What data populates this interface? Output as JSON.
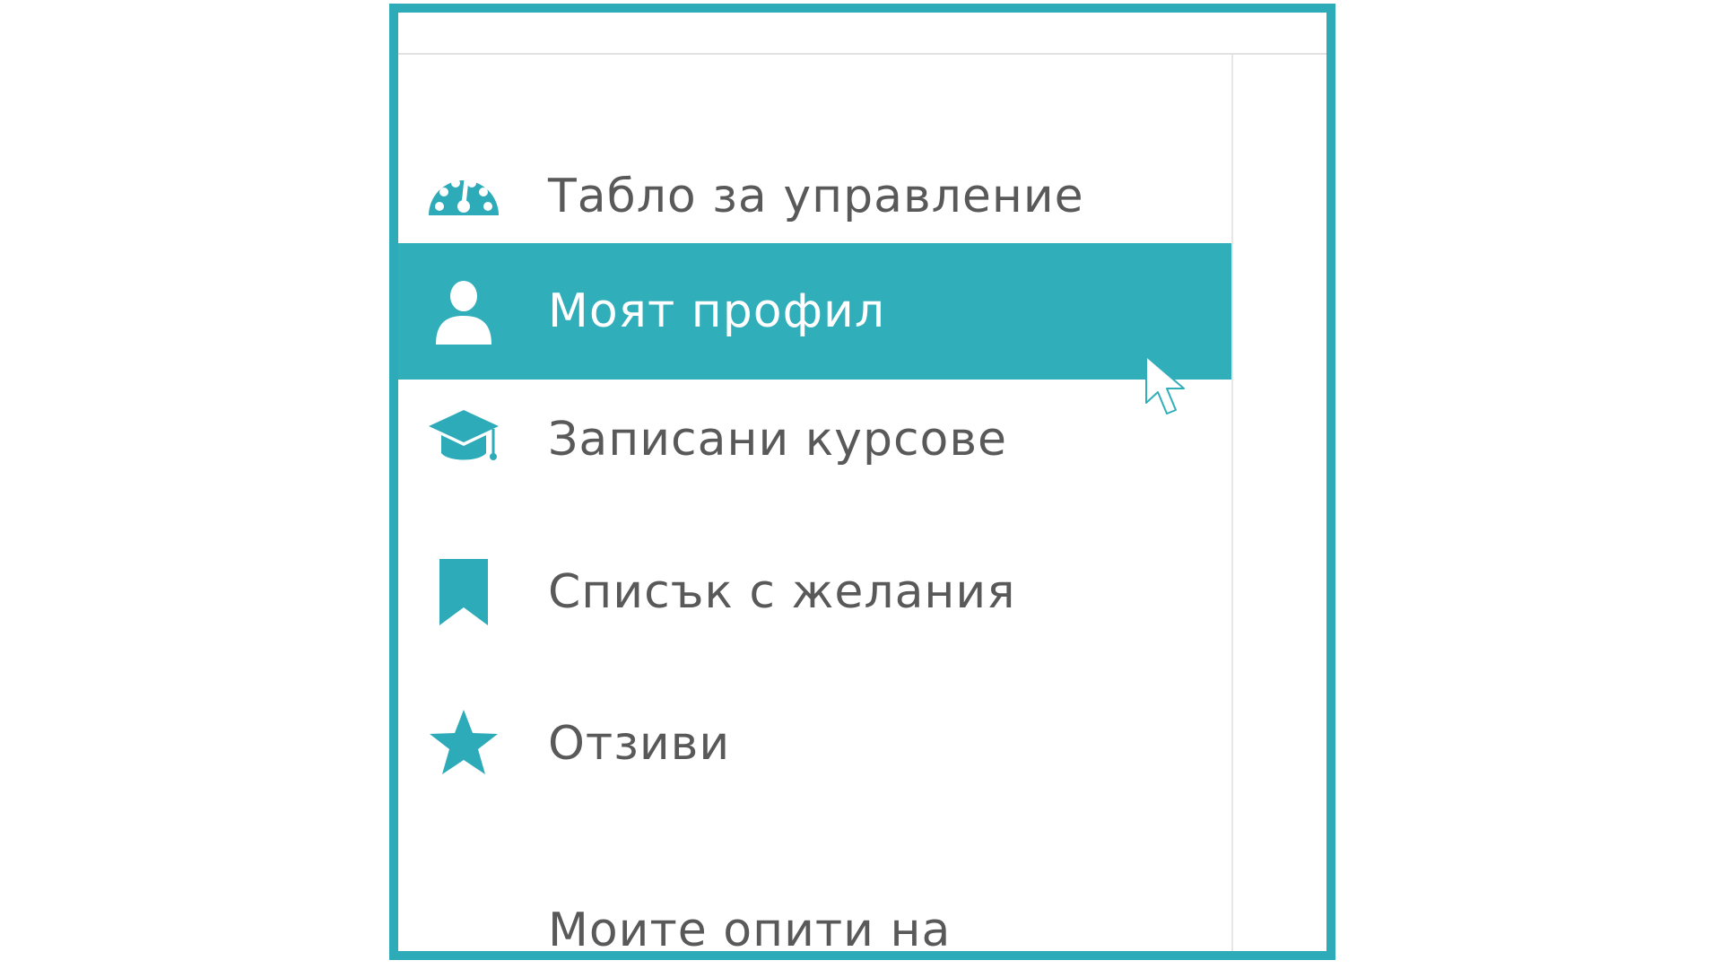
{
  "colors": {
    "accent": "#2eabb8",
    "active_bg": "#30aeb9",
    "text": "#595959",
    "active_text": "#ffffff"
  },
  "sidebar": {
    "items": [
      {
        "label": "Табло за управление",
        "icon": "dashboard-icon",
        "active": false
      },
      {
        "label": "Моят профил",
        "icon": "user-icon",
        "active": true
      },
      {
        "label": "Записани курсове",
        "icon": "graduation-cap-icon",
        "active": false
      },
      {
        "label": "Списък с желания",
        "icon": "bookmark-icon",
        "active": false
      },
      {
        "label": "Отзиви",
        "icon": "star-icon",
        "active": false
      },
      {
        "label": "Моите опити на",
        "icon": "",
        "active": false
      }
    ]
  }
}
